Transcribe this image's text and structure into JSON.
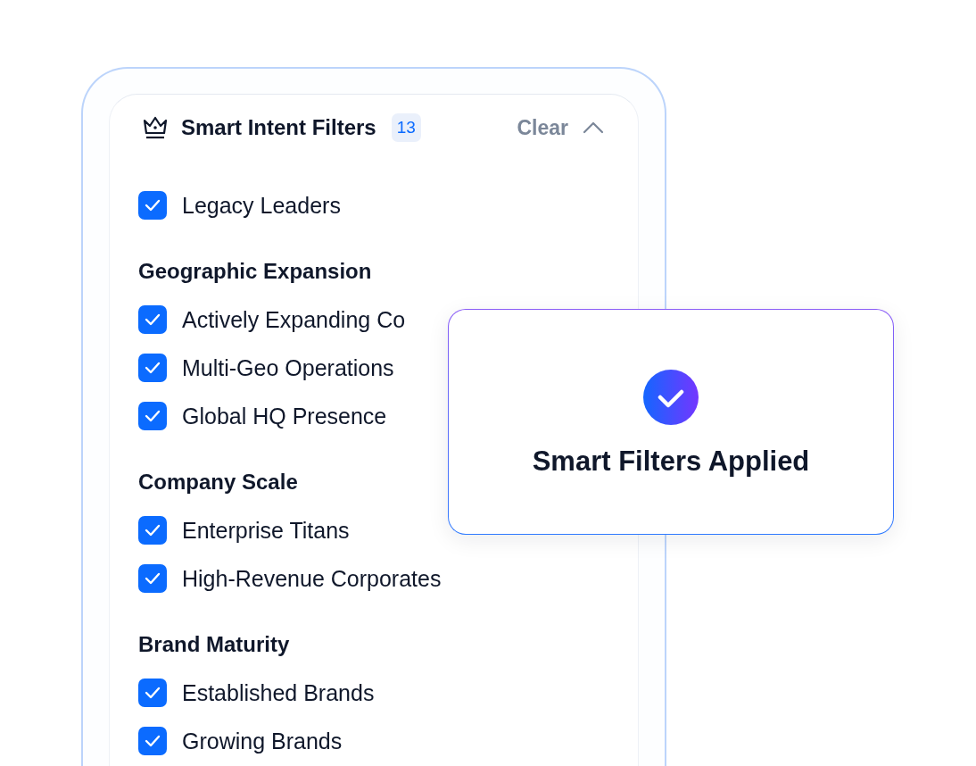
{
  "filter_panel": {
    "title": "Smart Intent Filters",
    "count": "13",
    "clear_label": "Clear",
    "expanded": true,
    "groups": [
      {
        "items": [
          {
            "label": "Legacy Leaders",
            "checked": true
          }
        ]
      },
      {
        "heading": "Geographic Expansion",
        "items": [
          {
            "label": "Actively Expanding Co",
            "checked": true
          },
          {
            "label": "Multi-Geo Operations",
            "checked": true
          },
          {
            "label": "Global HQ Presence",
            "checked": true
          }
        ]
      },
      {
        "heading": "Company Scale",
        "items": [
          {
            "label": "Enterprise Titans",
            "checked": true
          },
          {
            "label": "High-Revenue Corporates",
            "checked": true
          }
        ]
      },
      {
        "heading": "Brand Maturity",
        "items": [
          {
            "label": "Established Brands",
            "checked": true
          },
          {
            "label": "Growing Brands",
            "checked": true
          }
        ]
      }
    ]
  },
  "toast": {
    "title": "Smart Filters Applied"
  }
}
